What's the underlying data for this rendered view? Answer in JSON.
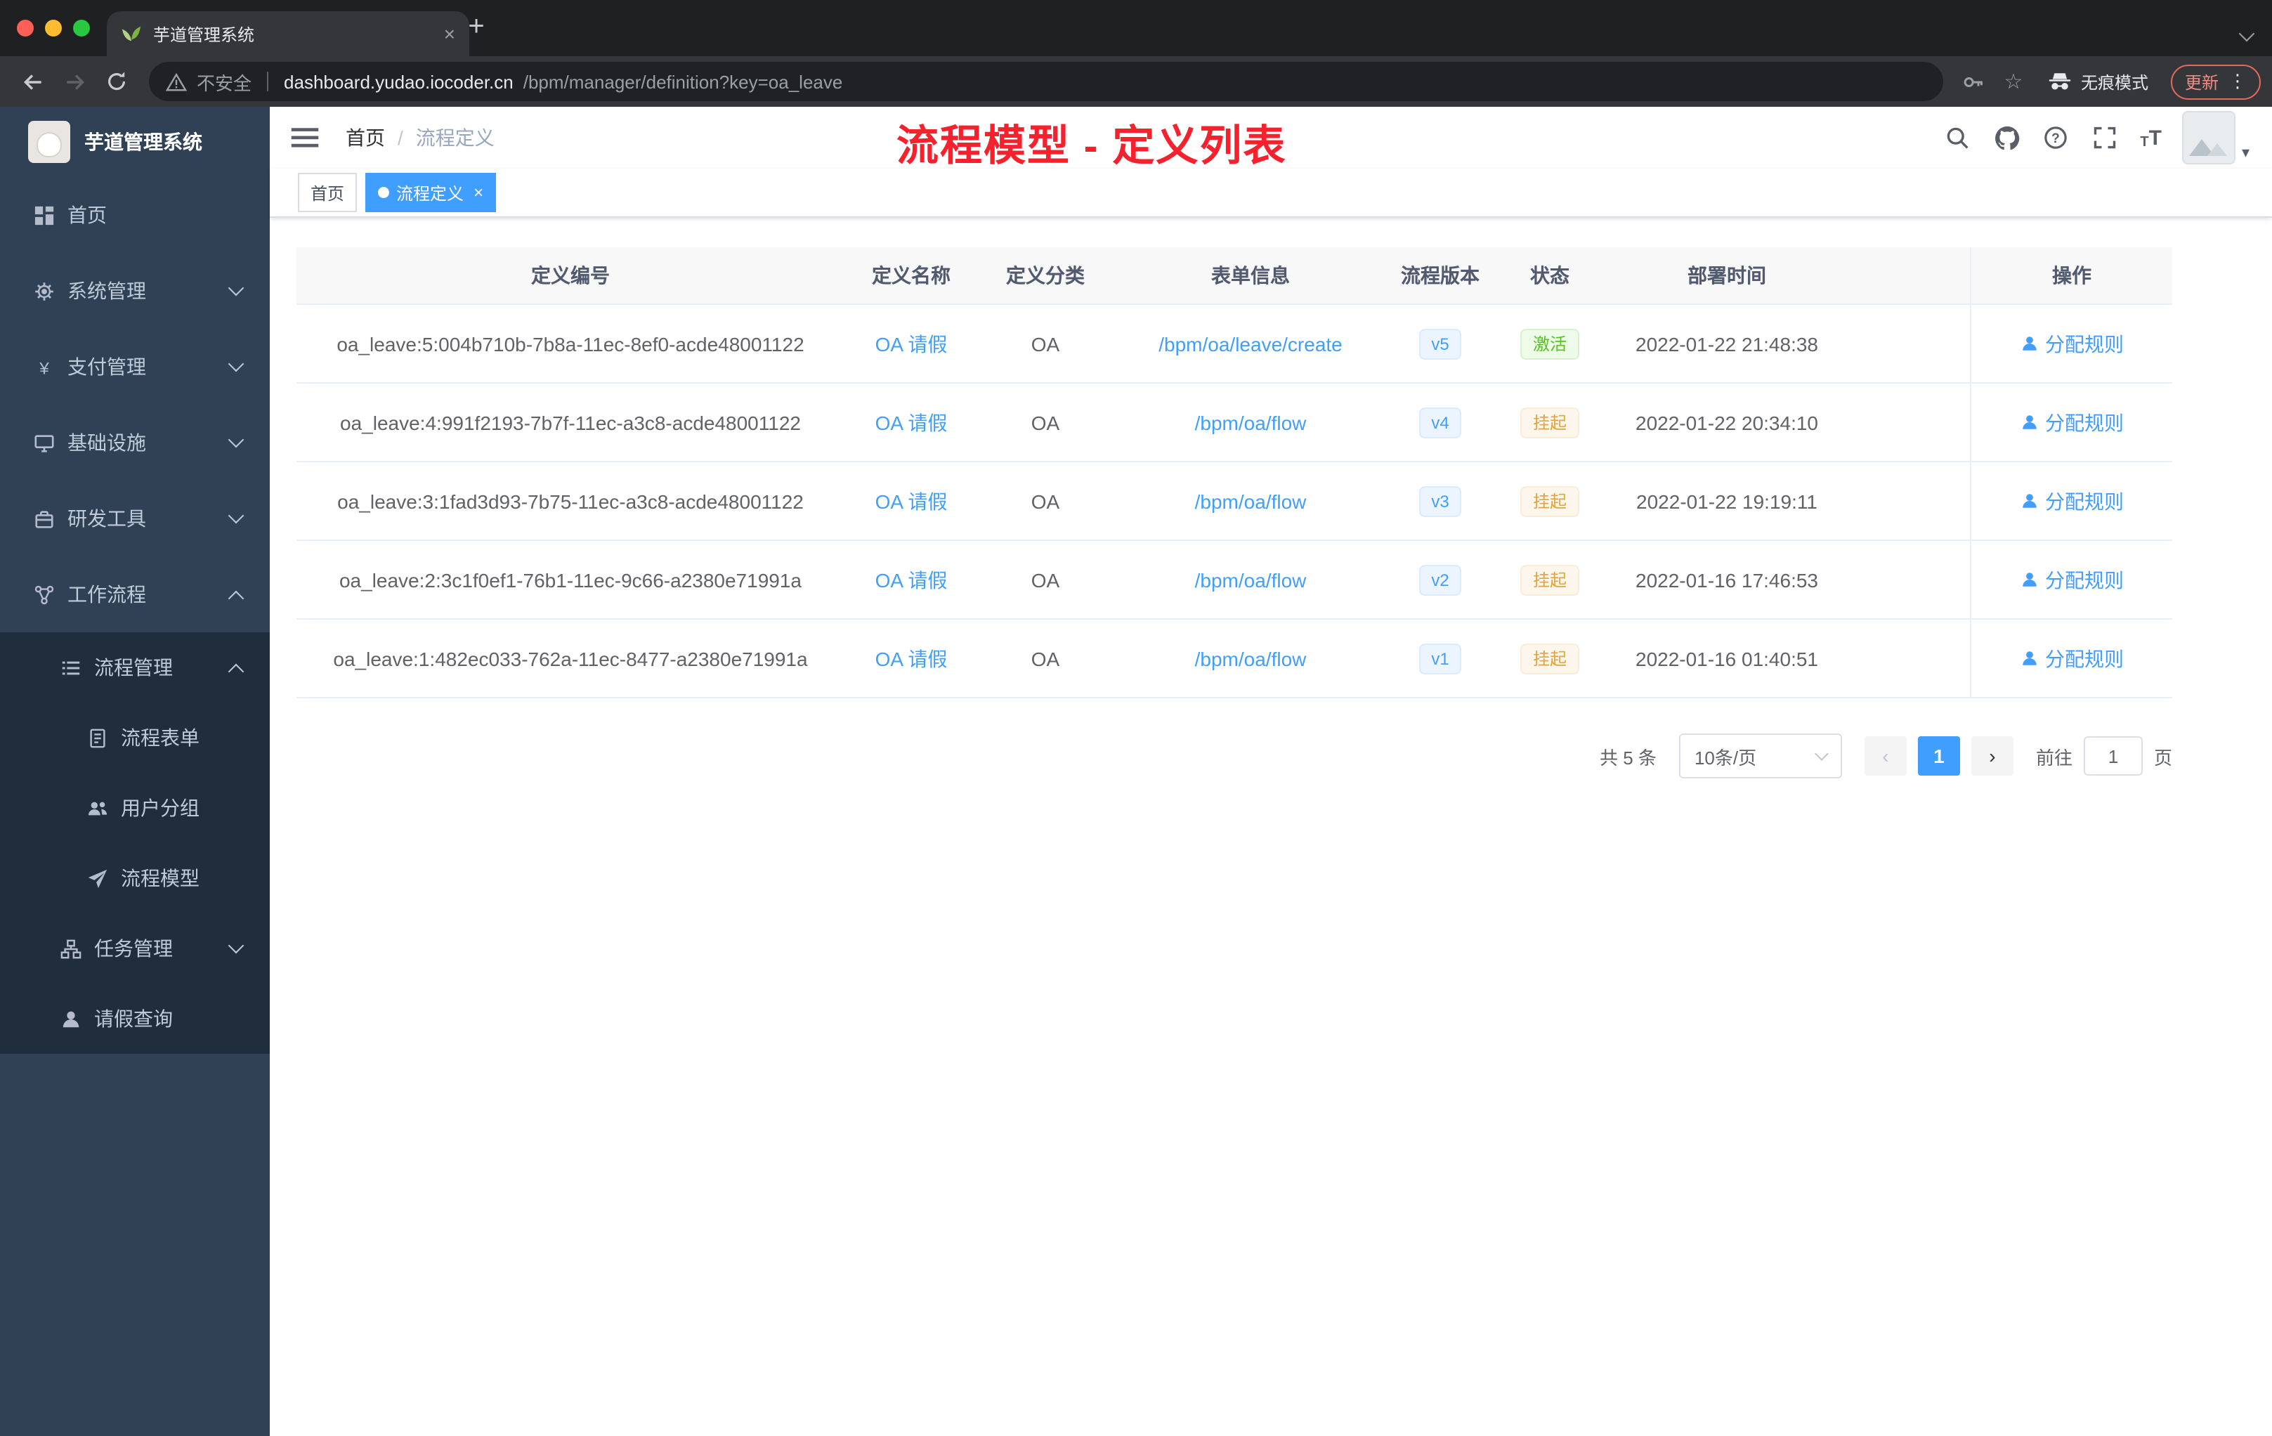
{
  "browser": {
    "tab_title": "芋道管理系统",
    "security_label": "不安全",
    "url_host": "dashboard.yudao.iocoder.cn",
    "url_path": "/bpm/manager/definition?key=oa_leave",
    "incognito_label": "无痕模式",
    "update_label": "更新"
  },
  "icons": {
    "close": "×",
    "new_tab": "+",
    "more": "⋮",
    "star": "☆",
    "caret_down": "▾",
    "breadcrumb_sep": "/",
    "prev": "‹",
    "next": "›"
  },
  "sidebar": {
    "logo_title": "芋道管理系统",
    "items": [
      {
        "label": "首页"
      },
      {
        "label": "系统管理"
      },
      {
        "label": "支付管理"
      },
      {
        "label": "基础设施"
      },
      {
        "label": "研发工具"
      },
      {
        "label": "工作流程"
      },
      {
        "label": "流程管理"
      },
      {
        "label": "流程表单"
      },
      {
        "label": "用户分组"
      },
      {
        "label": "流程模型"
      },
      {
        "label": "任务管理"
      },
      {
        "label": "请假查询"
      }
    ]
  },
  "header": {
    "breadcrumb": {
      "home": "首页",
      "current": "流程定义"
    },
    "annotation": "流程模型 - 定义列表"
  },
  "tags": {
    "home": "首页",
    "active": "流程定义"
  },
  "table": {
    "columns": [
      "定义编号",
      "定义名称",
      "定义分类",
      "表单信息",
      "流程版本",
      "状态",
      "部署时间",
      "操作"
    ],
    "rows": [
      {
        "id": "oa_leave:5:004b710b-7b8a-11ec-8ef0-acde48001122",
        "name": "OA 请假",
        "category": "OA",
        "form": "/bpm/oa/leave/create",
        "version": "v5",
        "status": "激活",
        "time": "2022-01-22 21:48:38",
        "action": "分配规则"
      },
      {
        "id": "oa_leave:4:991f2193-7b7f-11ec-a3c8-acde48001122",
        "name": "OA 请假",
        "category": "OA",
        "form": "/bpm/oa/flow",
        "version": "v4",
        "status": "挂起",
        "time": "2022-01-22 20:34:10",
        "action": "分配规则"
      },
      {
        "id": "oa_leave:3:1fad3d93-7b75-11ec-a3c8-acde48001122",
        "name": "OA 请假",
        "category": "OA",
        "form": "/bpm/oa/flow",
        "version": "v3",
        "status": "挂起",
        "time": "2022-01-22 19:19:11",
        "action": "分配规则"
      },
      {
        "id": "oa_leave:2:3c1f0ef1-76b1-11ec-9c66-a2380e71991a",
        "name": "OA 请假",
        "category": "OA",
        "form": "/bpm/oa/flow",
        "version": "v2",
        "status": "挂起",
        "time": "2022-01-16 17:46:53",
        "action": "分配规则"
      },
      {
        "id": "oa_leave:1:482ec033-762a-11ec-8477-a2380e71991a",
        "name": "OA 请假",
        "category": "OA",
        "form": "/bpm/oa/flow",
        "version": "v1",
        "status": "挂起",
        "time": "2022-01-16 01:40:51",
        "action": "分配规则"
      }
    ]
  },
  "pagination": {
    "total": "共 5 条",
    "page_size": "10条/页",
    "page": "1",
    "goto_label": "前往",
    "goto_value": "1",
    "goto_suffix": "页"
  },
  "colors": {
    "accent": "#409eff",
    "success": "#52c41a",
    "warning": "#e6a23c",
    "annotation_red": "#f5222d",
    "sidebar_bg": "#304156",
    "submenu_bg": "#1f2d3d"
  }
}
